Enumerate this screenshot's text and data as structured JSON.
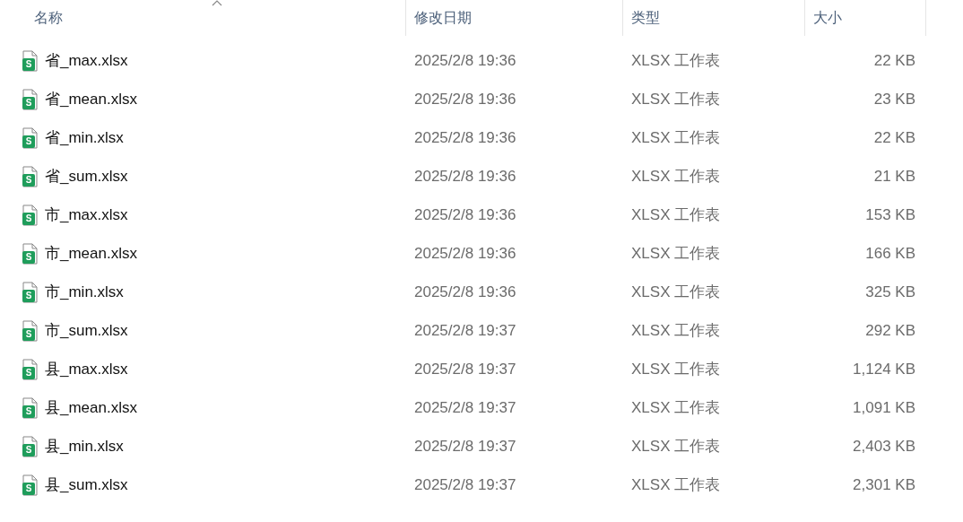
{
  "columns": [
    {
      "label": "名称",
      "sorted": true
    },
    {
      "label": "修改日期",
      "sorted": false
    },
    {
      "label": "类型",
      "sorted": false
    },
    {
      "label": "大小",
      "sorted": false
    }
  ],
  "rows": [
    {
      "icon_label": "S",
      "name": "省_max.xlsx",
      "modified": "2025/2/8 19:36",
      "type": "XLSX 工作表",
      "size": "22 KB"
    },
    {
      "icon_label": "S",
      "name": "省_mean.xlsx",
      "modified": "2025/2/8 19:36",
      "type": "XLSX 工作表",
      "size": "23 KB"
    },
    {
      "icon_label": "S",
      "name": "省_min.xlsx",
      "modified": "2025/2/8 19:36",
      "type": "XLSX 工作表",
      "size": "22 KB"
    },
    {
      "icon_label": "S",
      "name": "省_sum.xlsx",
      "modified": "2025/2/8 19:36",
      "type": "XLSX 工作表",
      "size": "21 KB"
    },
    {
      "icon_label": "S",
      "name": "市_max.xlsx",
      "modified": "2025/2/8 19:36",
      "type": "XLSX 工作表",
      "size": "153 KB"
    },
    {
      "icon_label": "S",
      "name": "市_mean.xlsx",
      "modified": "2025/2/8 19:36",
      "type": "XLSX 工作表",
      "size": "166 KB"
    },
    {
      "icon_label": "S",
      "name": "市_min.xlsx",
      "modified": "2025/2/8 19:36",
      "type": "XLSX 工作表",
      "size": "325 KB"
    },
    {
      "icon_label": "S",
      "name": "市_sum.xlsx",
      "modified": "2025/2/8 19:37",
      "type": "XLSX 工作表",
      "size": "292 KB"
    },
    {
      "icon_label": "S",
      "name": "县_max.xlsx",
      "modified": "2025/2/8 19:37",
      "type": "XLSX 工作表",
      "size": "1,124 KB"
    },
    {
      "icon_label": "S",
      "name": "县_mean.xlsx",
      "modified": "2025/2/8 19:37",
      "type": "XLSX 工作表",
      "size": "1,091 KB"
    },
    {
      "icon_label": "S",
      "name": "县_min.xlsx",
      "modified": "2025/2/8 19:37",
      "type": "XLSX 工作表",
      "size": "2,403 KB"
    },
    {
      "icon_label": "S",
      "name": "县_sum.xlsx",
      "modified": "2025/2/8 19:37",
      "type": "XLSX 工作表",
      "size": "2,301 KB"
    }
  ]
}
